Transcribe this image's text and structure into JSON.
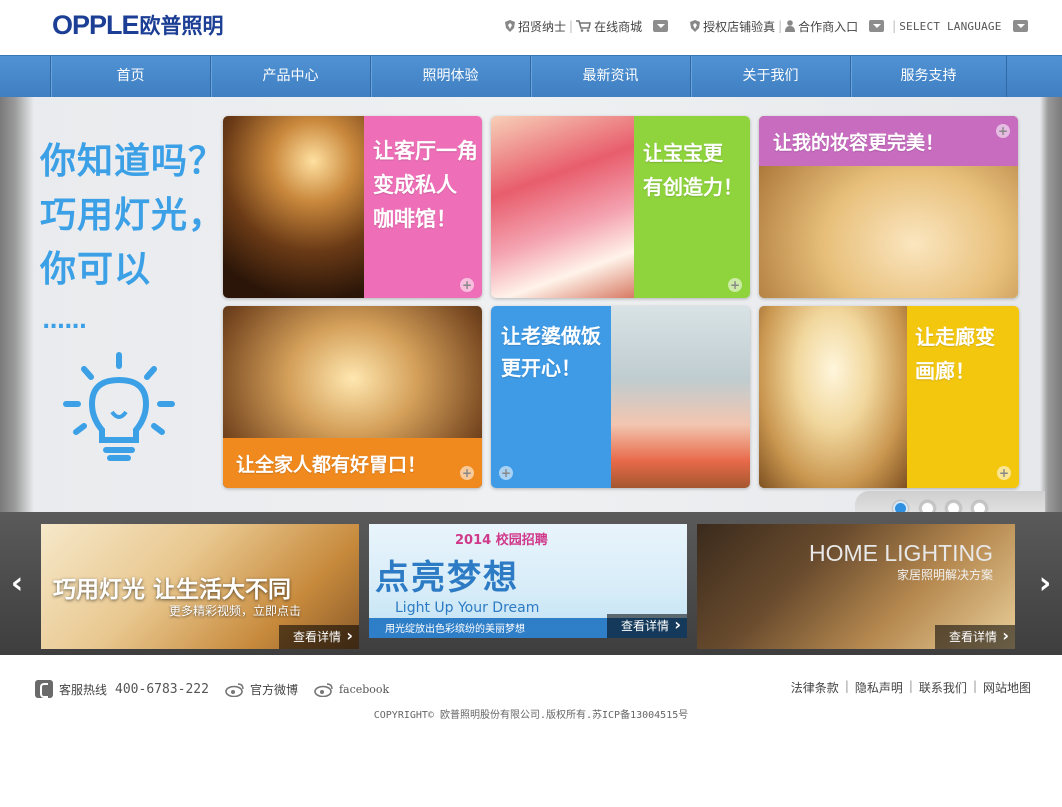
{
  "header": {
    "logo_en": "OPPLE",
    "logo_cn": "欧普照明",
    "links": [
      {
        "label": "招贤纳士",
        "icon": "shield-icon"
      },
      {
        "label": "在线商城",
        "icon": "cart-icon"
      },
      {
        "label": "授权店铺验真",
        "icon": "shield-icon"
      },
      {
        "label": "合作商入口",
        "icon": "user-icon"
      }
    ],
    "language_label": "SELECT LANGUAGE"
  },
  "nav": {
    "items": [
      "首页",
      "产品中心",
      "照明体验",
      "最新资讯",
      "关于我们",
      "服务支持"
    ]
  },
  "banner": {
    "headline": [
      "你知道吗？",
      "巧用灯光，",
      "你可以"
    ],
    "ellipsis": "......",
    "tiles": [
      {
        "text": [
          "让客厅一角",
          "变成私人",
          "咖啡馆！"
        ],
        "color": "#ee6fb7"
      },
      {
        "text": [
          "让宝宝更",
          "有创造力！"
        ],
        "color": "#8fd33d"
      },
      {
        "text": [
          "让我的妆容更完美！"
        ],
        "color": "#c86cc0"
      },
      {
        "text": [
          "让全家人都有好胃口！"
        ],
        "color": "#f08a1e"
      },
      {
        "text": [
          "让老婆做饭",
          "更开心！"
        ],
        "color": "#3f9be6"
      },
      {
        "text": [
          "让走廊变",
          "画廊！"
        ],
        "color": "#f4c70f"
      }
    ],
    "pager": {
      "total": 4,
      "active": 0
    }
  },
  "strip": {
    "items": [
      {
        "title": "巧用灯光 让生活大不同",
        "subtitle": "更多精彩视频，立即点击",
        "more": "查看详情"
      },
      {
        "badge": "2014 校园招聘",
        "title": "点亮梦想",
        "subtitle": "Light Up Your Dream",
        "caption": "用光绽放出色彩缤纷的美丽梦想",
        "more": "查看详情"
      },
      {
        "title": "HOME LIGHTING",
        "subtitle": "家居照明解决方案",
        "more": "查看详情"
      }
    ]
  },
  "footer": {
    "hotline_label": "客服热线",
    "hotline_number": "400-6783-222",
    "weibo": "官方微博",
    "facebook": "facebook",
    "links": [
      "法律条款",
      "隐私声明",
      "联系我们",
      "网站地图"
    ],
    "copyright": "COPYRIGHT© 欧普照明股份有限公司.版权所有.苏ICP备13004515号"
  }
}
